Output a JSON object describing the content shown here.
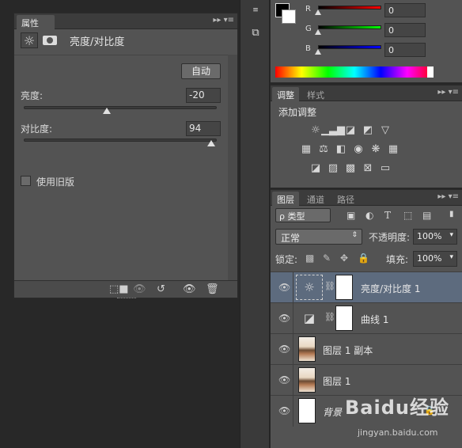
{
  "properties": {
    "tab_label": "属性",
    "title": "亮度/对比度",
    "auto_label": "自动",
    "brightness_label": "亮度:",
    "brightness_value": "-20",
    "brightness_level": 0.43,
    "contrast_label": "对比度:",
    "contrast_value": "94",
    "contrast_level": 0.97,
    "legacy_label": "使用旧版"
  },
  "color": {
    "channels": [
      {
        "label": "R",
        "value": "0"
      },
      {
        "label": "G",
        "value": "0"
      },
      {
        "label": "B",
        "value": "0"
      }
    ]
  },
  "adjustments": {
    "tabs": [
      "调整",
      "样式"
    ],
    "title": "添加调整"
  },
  "layers": {
    "tabs": [
      "图层",
      "通道",
      "路径"
    ],
    "kind_label": "ρ 类型",
    "blend_mode": "正常",
    "opacity_label": "不透明度:",
    "opacity_value": "100%",
    "lock_label": "锁定:",
    "fill_label": "填充:",
    "fill_value": "100%",
    "items": [
      {
        "name": "亮度/对比度 1"
      },
      {
        "name": "曲线 1"
      },
      {
        "name": "图层 1 副本"
      },
      {
        "name": "图层 1"
      },
      {
        "name": "背景"
      }
    ]
  },
  "watermark": {
    "brand": "Baidu经验",
    "url": "jingyan.baidu.com"
  }
}
